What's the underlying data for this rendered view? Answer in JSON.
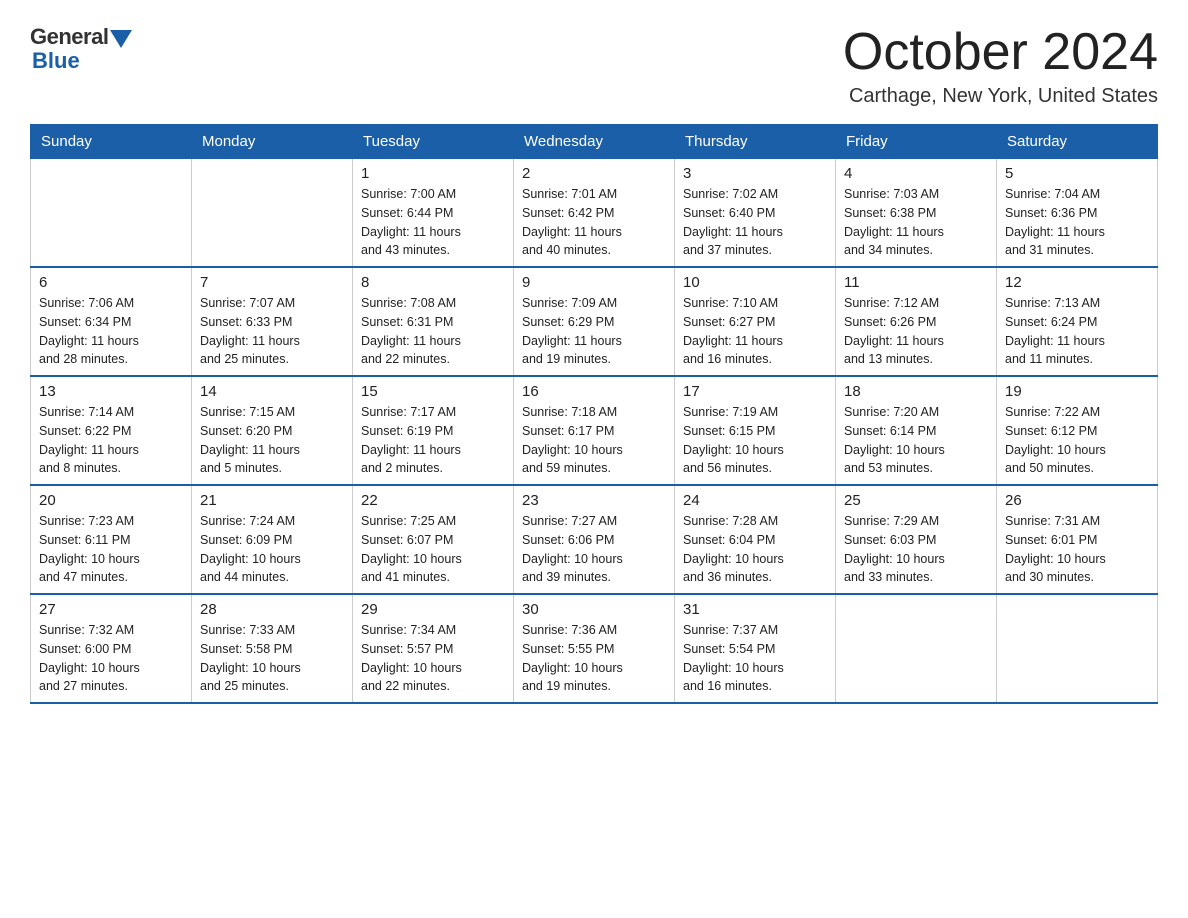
{
  "logo": {
    "general": "General",
    "blue": "Blue"
  },
  "header": {
    "month": "October 2024",
    "location": "Carthage, New York, United States"
  },
  "weekdays": [
    "Sunday",
    "Monday",
    "Tuesday",
    "Wednesday",
    "Thursday",
    "Friday",
    "Saturday"
  ],
  "weeks": [
    [
      {
        "day": "",
        "info": ""
      },
      {
        "day": "",
        "info": ""
      },
      {
        "day": "1",
        "info": "Sunrise: 7:00 AM\nSunset: 6:44 PM\nDaylight: 11 hours\nand 43 minutes."
      },
      {
        "day": "2",
        "info": "Sunrise: 7:01 AM\nSunset: 6:42 PM\nDaylight: 11 hours\nand 40 minutes."
      },
      {
        "day": "3",
        "info": "Sunrise: 7:02 AM\nSunset: 6:40 PM\nDaylight: 11 hours\nand 37 minutes."
      },
      {
        "day": "4",
        "info": "Sunrise: 7:03 AM\nSunset: 6:38 PM\nDaylight: 11 hours\nand 34 minutes."
      },
      {
        "day": "5",
        "info": "Sunrise: 7:04 AM\nSunset: 6:36 PM\nDaylight: 11 hours\nand 31 minutes."
      }
    ],
    [
      {
        "day": "6",
        "info": "Sunrise: 7:06 AM\nSunset: 6:34 PM\nDaylight: 11 hours\nand 28 minutes."
      },
      {
        "day": "7",
        "info": "Sunrise: 7:07 AM\nSunset: 6:33 PM\nDaylight: 11 hours\nand 25 minutes."
      },
      {
        "day": "8",
        "info": "Sunrise: 7:08 AM\nSunset: 6:31 PM\nDaylight: 11 hours\nand 22 minutes."
      },
      {
        "day": "9",
        "info": "Sunrise: 7:09 AM\nSunset: 6:29 PM\nDaylight: 11 hours\nand 19 minutes."
      },
      {
        "day": "10",
        "info": "Sunrise: 7:10 AM\nSunset: 6:27 PM\nDaylight: 11 hours\nand 16 minutes."
      },
      {
        "day": "11",
        "info": "Sunrise: 7:12 AM\nSunset: 6:26 PM\nDaylight: 11 hours\nand 13 minutes."
      },
      {
        "day": "12",
        "info": "Sunrise: 7:13 AM\nSunset: 6:24 PM\nDaylight: 11 hours\nand 11 minutes."
      }
    ],
    [
      {
        "day": "13",
        "info": "Sunrise: 7:14 AM\nSunset: 6:22 PM\nDaylight: 11 hours\nand 8 minutes."
      },
      {
        "day": "14",
        "info": "Sunrise: 7:15 AM\nSunset: 6:20 PM\nDaylight: 11 hours\nand 5 minutes."
      },
      {
        "day": "15",
        "info": "Sunrise: 7:17 AM\nSunset: 6:19 PM\nDaylight: 11 hours\nand 2 minutes."
      },
      {
        "day": "16",
        "info": "Sunrise: 7:18 AM\nSunset: 6:17 PM\nDaylight: 10 hours\nand 59 minutes."
      },
      {
        "day": "17",
        "info": "Sunrise: 7:19 AM\nSunset: 6:15 PM\nDaylight: 10 hours\nand 56 minutes."
      },
      {
        "day": "18",
        "info": "Sunrise: 7:20 AM\nSunset: 6:14 PM\nDaylight: 10 hours\nand 53 minutes."
      },
      {
        "day": "19",
        "info": "Sunrise: 7:22 AM\nSunset: 6:12 PM\nDaylight: 10 hours\nand 50 minutes."
      }
    ],
    [
      {
        "day": "20",
        "info": "Sunrise: 7:23 AM\nSunset: 6:11 PM\nDaylight: 10 hours\nand 47 minutes."
      },
      {
        "day": "21",
        "info": "Sunrise: 7:24 AM\nSunset: 6:09 PM\nDaylight: 10 hours\nand 44 minutes."
      },
      {
        "day": "22",
        "info": "Sunrise: 7:25 AM\nSunset: 6:07 PM\nDaylight: 10 hours\nand 41 minutes."
      },
      {
        "day": "23",
        "info": "Sunrise: 7:27 AM\nSunset: 6:06 PM\nDaylight: 10 hours\nand 39 minutes."
      },
      {
        "day": "24",
        "info": "Sunrise: 7:28 AM\nSunset: 6:04 PM\nDaylight: 10 hours\nand 36 minutes."
      },
      {
        "day": "25",
        "info": "Sunrise: 7:29 AM\nSunset: 6:03 PM\nDaylight: 10 hours\nand 33 minutes."
      },
      {
        "day": "26",
        "info": "Sunrise: 7:31 AM\nSunset: 6:01 PM\nDaylight: 10 hours\nand 30 minutes."
      }
    ],
    [
      {
        "day": "27",
        "info": "Sunrise: 7:32 AM\nSunset: 6:00 PM\nDaylight: 10 hours\nand 27 minutes."
      },
      {
        "day": "28",
        "info": "Sunrise: 7:33 AM\nSunset: 5:58 PM\nDaylight: 10 hours\nand 25 minutes."
      },
      {
        "day": "29",
        "info": "Sunrise: 7:34 AM\nSunset: 5:57 PM\nDaylight: 10 hours\nand 22 minutes."
      },
      {
        "day": "30",
        "info": "Sunrise: 7:36 AM\nSunset: 5:55 PM\nDaylight: 10 hours\nand 19 minutes."
      },
      {
        "day": "31",
        "info": "Sunrise: 7:37 AM\nSunset: 5:54 PM\nDaylight: 10 hours\nand 16 minutes."
      },
      {
        "day": "",
        "info": ""
      },
      {
        "day": "",
        "info": ""
      }
    ]
  ]
}
